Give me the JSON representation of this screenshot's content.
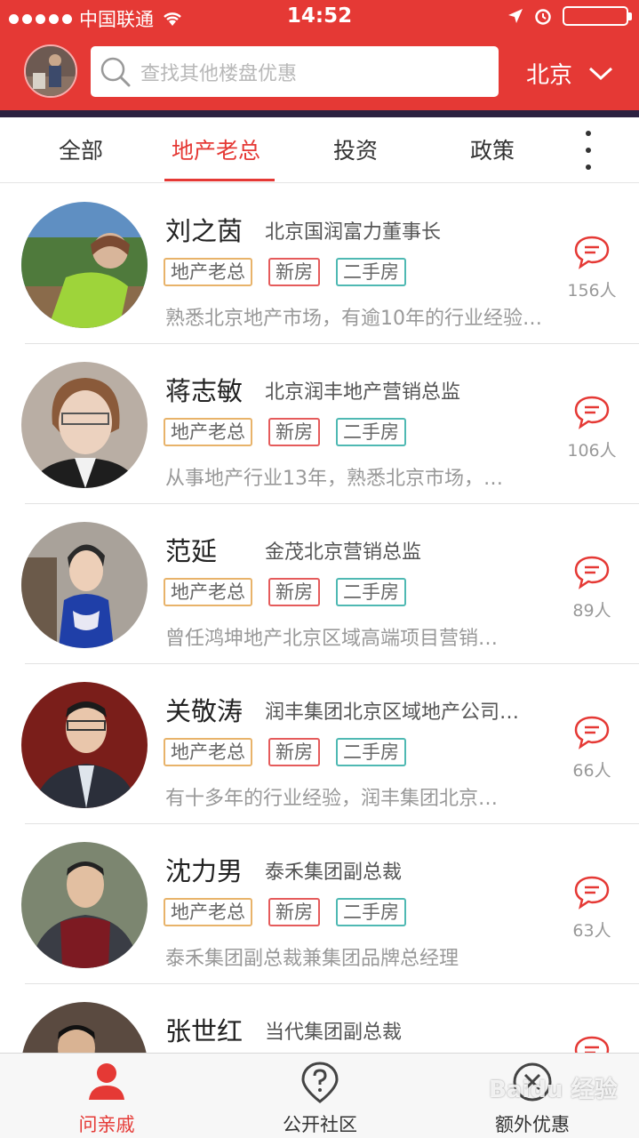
{
  "status": {
    "carrier": "中国联通",
    "time": "14:52"
  },
  "header": {
    "search_placeholder": "查找其他楼盘优惠",
    "city": "北京"
  },
  "tabs": [
    {
      "label": "全部",
      "active": false
    },
    {
      "label": "地产老总",
      "active": true
    },
    {
      "label": "投资",
      "active": false
    },
    {
      "label": "政策",
      "active": false
    }
  ],
  "list": [
    {
      "name": "刘之茵",
      "title": "北京国润富力董事长",
      "tags": [
        "地产老总",
        "新房",
        "二手房"
      ],
      "desc": "熟悉北京地产市场，有逾10年的行业经验…",
      "count": "156人"
    },
    {
      "name": "蒋志敏",
      "title": "北京润丰地产营销总监",
      "tags": [
        "地产老总",
        "新房",
        "二手房"
      ],
      "desc": "从事地产行业13年，熟悉北京市场，…",
      "count": "106人"
    },
    {
      "name": "范延",
      "title": "金茂北京营销总监",
      "tags": [
        "地产老总",
        "新房",
        "二手房"
      ],
      "desc": "曾任鸿坤地产北京区域高端项目营销…",
      "count": "89人"
    },
    {
      "name": "关敬涛",
      "title": "润丰集团北京区域地产公司…",
      "tags": [
        "地产老总",
        "新房",
        "二手房"
      ],
      "desc": "有十多年的行业经验，润丰集团北京…",
      "count": "66人"
    },
    {
      "name": "沈力男",
      "title": "泰禾集团副总裁",
      "tags": [
        "地产老总",
        "新房",
        "二手房"
      ],
      "desc": "泰禾集团副总裁兼集团品牌总经理",
      "count": "63人"
    },
    {
      "name": "张世红",
      "title": "当代集团副总裁"
    }
  ],
  "bottom_nav": [
    {
      "label": "问亲戚",
      "icon": "person-icon",
      "active": true
    },
    {
      "label": "公开社区",
      "icon": "question-pin-icon",
      "active": false
    },
    {
      "label": "额外优惠",
      "icon": "discount-icon",
      "active": false
    }
  ],
  "watermark": "Baidu 经验",
  "colors": {
    "brand_red": "#e53935",
    "tag_gold": "#e8b36a",
    "tag_red": "#e55b5b",
    "tag_teal": "#4fb9b3"
  }
}
